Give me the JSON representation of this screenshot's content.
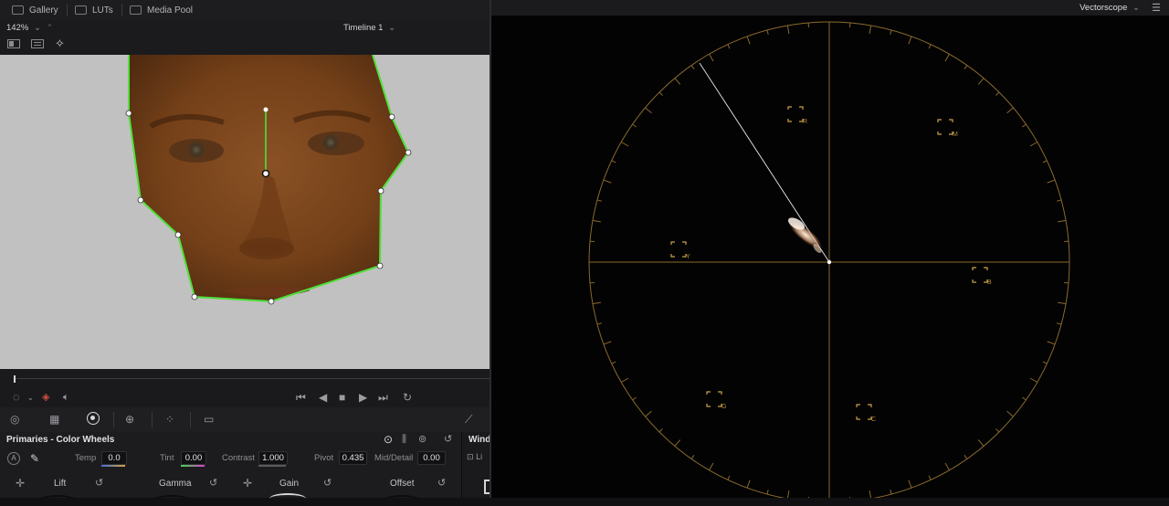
{
  "tabs": [
    {
      "label": "Gallery",
      "icon": "gallery-icon"
    },
    {
      "label": "LUTs",
      "icon": "luts-icon"
    },
    {
      "label": "Media Pool",
      "icon": "media-pool-icon"
    }
  ],
  "viewer": {
    "zoom": "142%",
    "timeline": "Timeline 1"
  },
  "scope": {
    "title": "Vectorscope",
    "targets": [
      "R",
      "M",
      "B",
      "C",
      "G",
      "Y"
    ]
  },
  "primaries": {
    "title": "Primaries - Color Wheels",
    "temp_label": "Temp",
    "temp_value": "0.0",
    "tint_label": "Tint",
    "tint_value": "0.00",
    "contrast_label": "Contrast",
    "contrast_value": "1.000",
    "pivot_label": "Pivot",
    "pivot_value": "0.435",
    "middetail_label": "Mid/Detail",
    "middetail_value": "0.00",
    "wheels": [
      "Lift",
      "Gamma",
      "Gain",
      "Offset"
    ]
  },
  "window_panel": {
    "title": "Windo",
    "item": "Li"
  },
  "colors": {
    "accent_green": "#4fe03a",
    "scope_graticule": "#8a6a2c",
    "viewer_bg": "#c1c1c1"
  }
}
